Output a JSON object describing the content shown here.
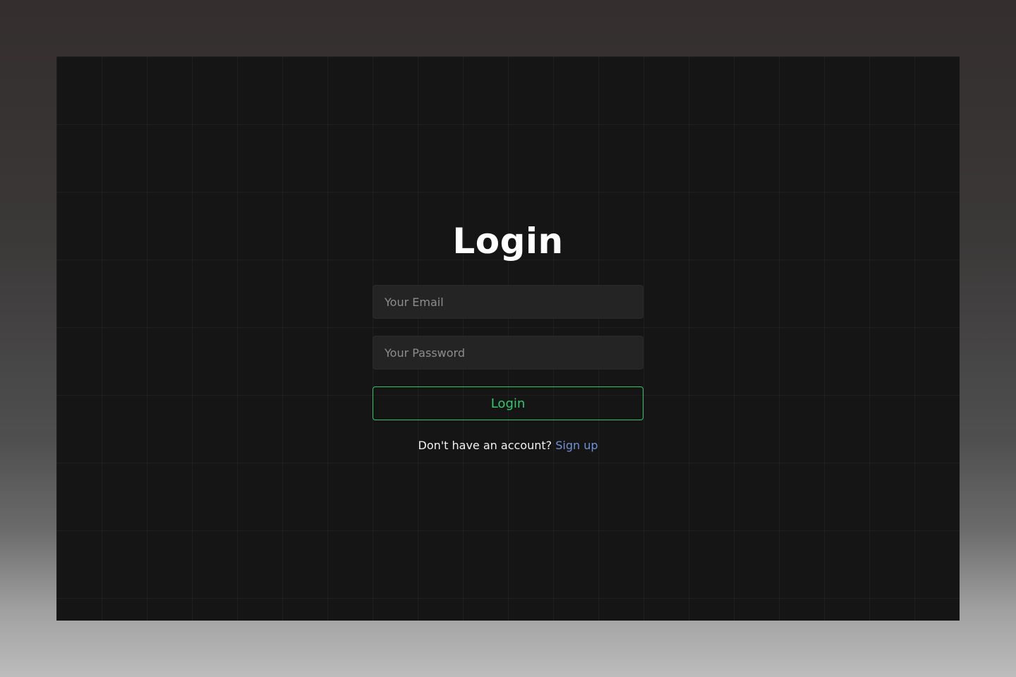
{
  "login": {
    "title": "Login",
    "email_placeholder": "Your Email",
    "password_placeholder": "Your Password",
    "button_label": "Login",
    "signup_prompt": "Don't have an account?",
    "signup_link": "Sign up"
  },
  "colors": {
    "panel_background": "#151515",
    "input_background": "#242424",
    "accent_green": "#39c46e",
    "link_blue": "#6f92d6",
    "text_primary": "#ffffff"
  }
}
